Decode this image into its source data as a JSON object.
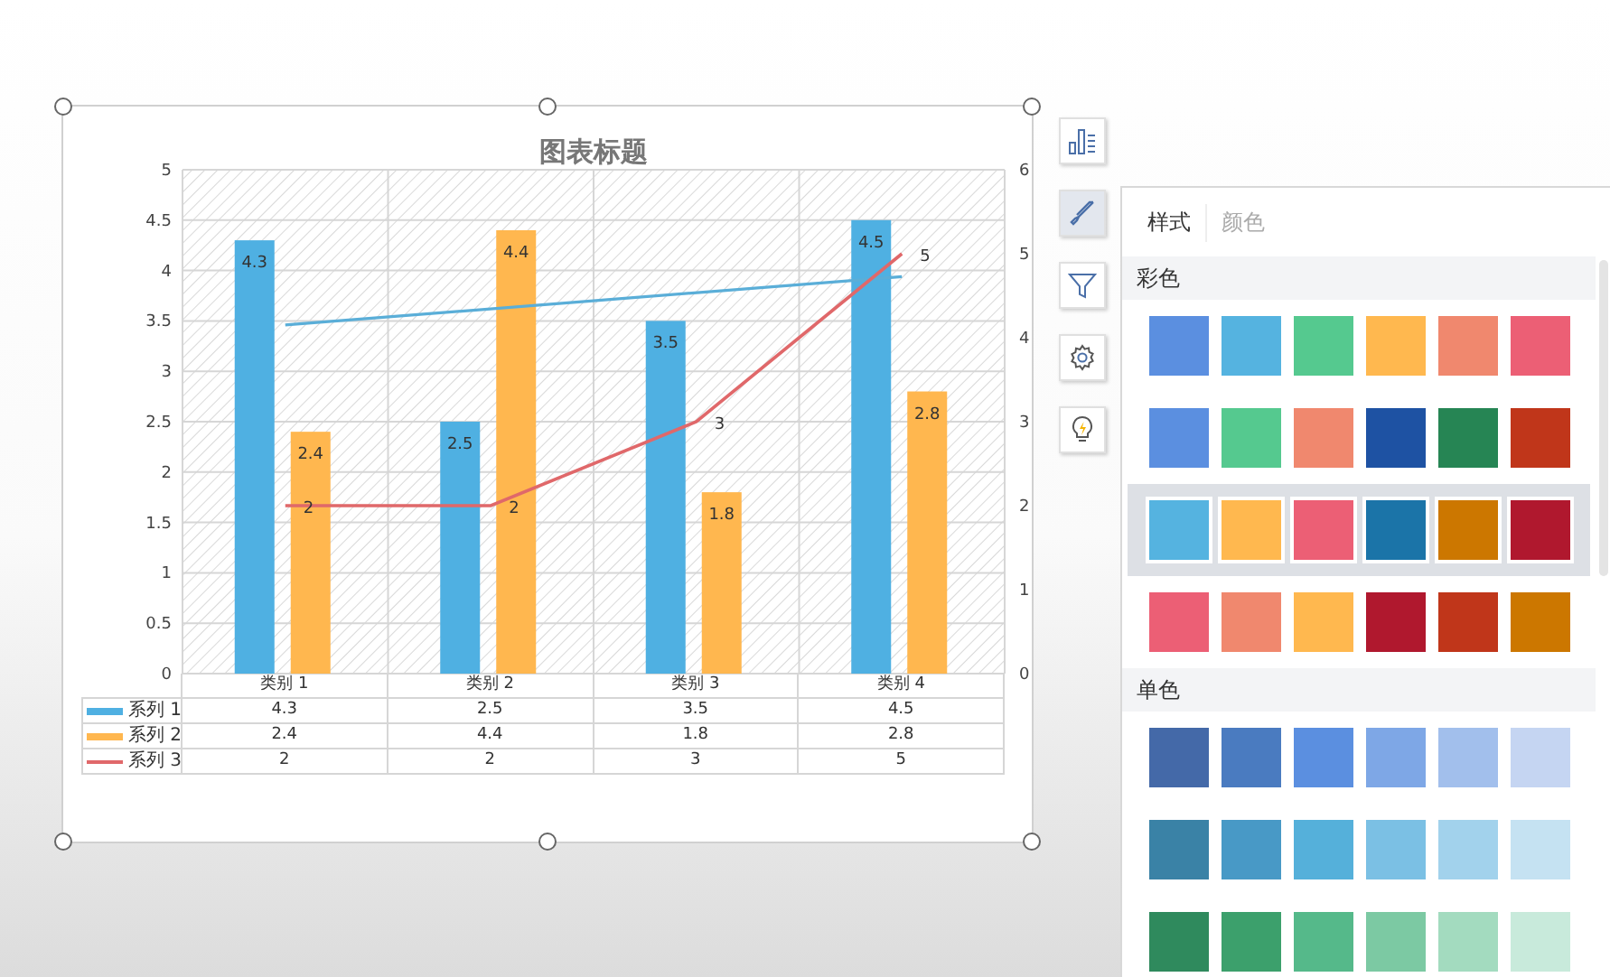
{
  "chart": {
    "chart_data": {
      "type": "bar",
      "title": "图表标题",
      "categories": [
        "类别 1",
        "类别 2",
        "类别 3",
        "类别 4"
      ],
      "series": [
        {
          "name": "系列 1",
          "color": "#4fb0e2",
          "values": [
            4.3,
            2.5,
            3.5,
            4.5
          ]
        },
        {
          "name": "系列 2",
          "color": "#ffb74f",
          "values": [
            2.4,
            4.4,
            1.8,
            2.8
          ]
        },
        {
          "name": "系列 3",
          "color": "#e0686a",
          "values": [
            2,
            2,
            3,
            5
          ],
          "axis": "y2",
          "type": "line"
        }
      ],
      "ylim": [
        0,
        5
      ],
      "yticks": [
        0,
        0.5,
        1,
        1.5,
        2,
        2.5,
        3,
        3.5,
        4,
        4.5,
        5
      ],
      "y2lim": [
        0,
        6
      ],
      "y2ticks": [
        0,
        1,
        2,
        3,
        4,
        5,
        6
      ],
      "grid": true,
      "legend": "bottom",
      "value_labels": [
        [
          "4.3",
          "2.5",
          "3.5",
          "4.5"
        ],
        [
          "2.4",
          "4.4",
          "1.8",
          "2.8"
        ],
        [
          "2",
          "2",
          "3",
          "5"
        ]
      ]
    },
    "trendline": {
      "color": "#5aaed8"
    },
    "data_table": [
      [
        "4.3",
        "2.5",
        "3.5",
        "4.5"
      ],
      [
        "2.4",
        "4.4",
        "1.8",
        "2.8"
      ],
      [
        "2",
        "2",
        "3",
        "5"
      ]
    ]
  },
  "toolbar": [
    {
      "kind": "chart-elements",
      "selected": false
    },
    {
      "kind": "style",
      "selected": true
    },
    {
      "kind": "filter",
      "selected": false
    },
    {
      "kind": "settings",
      "selected": false
    },
    {
      "kind": "idea",
      "selected": false
    }
  ],
  "panel": {
    "tabs": [
      {
        "label": "样式",
        "selected": true
      },
      {
        "label": "颜色",
        "selected": false
      }
    ],
    "sections": [
      {
        "title": "彩色",
        "palettes": [
          {
            "selected": false,
            "colors": [
              {
                "color": "#5b8fe0"
              },
              {
                "color": "#55b3e0"
              },
              {
                "color": "#55c98f"
              },
              {
                "color": "#ffb84f"
              },
              {
                "color": "#f0886e"
              },
              {
                "color": "#ec5f75"
              }
            ]
          },
          {
            "selected": false,
            "colors": [
              {
                "color": "#5b8fe0"
              },
              {
                "color": "#55c98f"
              },
              {
                "color": "#f0886e"
              },
              {
                "color": "#1e52a3"
              },
              {
                "color": "#268554"
              },
              {
                "color": "#c0361a"
              }
            ]
          },
          {
            "selected": true,
            "colors": [
              {
                "color": "#55b3e0"
              },
              {
                "color": "#ffb84f"
              },
              {
                "color": "#ec5f75"
              },
              {
                "color": "#1b74a8"
              },
              {
                "color": "#cc7700"
              },
              {
                "color": "#b0182e"
              }
            ]
          },
          {
            "selected": false,
            "colors": [
              {
                "color": "#ec5f75"
              },
              {
                "color": "#f0886e"
              },
              {
                "color": "#ffb84f"
              },
              {
                "color": "#b0182e"
              },
              {
                "color": "#c0361a"
              },
              {
                "color": "#cc7700"
              }
            ]
          }
        ]
      },
      {
        "title": "单色",
        "palettes": [
          {
            "selected": false,
            "colors": [
              {
                "color": "#4469a8"
              },
              {
                "color": "#4a7bc0"
              },
              {
                "color": "#5b8fe0"
              },
              {
                "color": "#7ea7e6"
              },
              {
                "color": "#a2bfec"
              },
              {
                "color": "#c5d5f2"
              }
            ]
          },
          {
            "selected": false,
            "colors": [
              {
                "color": "#3a82a6"
              },
              {
                "color": "#4899c6"
              },
              {
                "color": "#55b0da"
              },
              {
                "color": "#7bc0e4"
              },
              {
                "color": "#a2d2ec"
              },
              {
                "color": "#c5e2f2"
              }
            ]
          },
          {
            "selected": false,
            "colors": [
              {
                "color": "#2f8a5d"
              },
              {
                "color": "#3ca06c"
              },
              {
                "color": "#55b98a"
              },
              {
                "color": "#7cc9a3"
              },
              {
                "color": "#a3dbbf"
              },
              {
                "color": "#c8eadb"
              }
            ]
          }
        ]
      }
    ]
  }
}
